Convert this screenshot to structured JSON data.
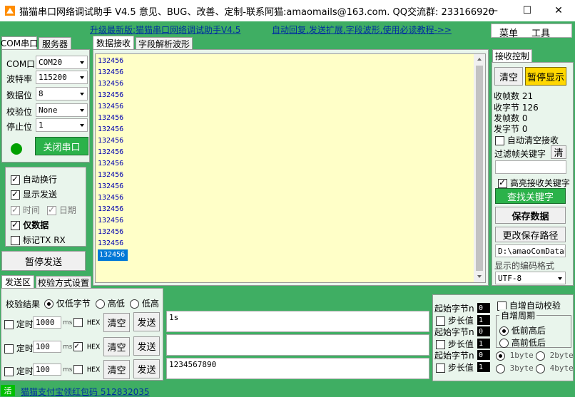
{
  "window": {
    "title": "猫猫串口网络调试助手 V4.5 意见、BUG、改善、定制-联系阿猫:amaomails@163.com. QQ交流群: 233166920",
    "minimize": "—",
    "maximize": "☐",
    "close": "✕"
  },
  "topbar": {
    "upgrade_link": "升级最新版:猫猫串口网络调试助手V4.5",
    "auto_reply_link": "自动回复,发送扩展,字段波形,使用必读教程->>",
    "menu": "菜单",
    "tools": "工具"
  },
  "left_tabs": {
    "com": "COM串口",
    "server": "服务器"
  },
  "com_settings": {
    "port_label": "COM口",
    "port_value": "COM20",
    "baud_label": "波特率",
    "baud_value": "115200",
    "data_label": "数据位",
    "data_value": "8",
    "parity_label": "校验位",
    "parity_value": "None",
    "stop_label": "停止位",
    "stop_value": "1",
    "close_port": "关闭串口",
    "indicator_color": "#00a000"
  },
  "options": {
    "auto_newline": "自动换行",
    "show_send": "显示发送",
    "time": "时间",
    "date": "日期",
    "data_only": "仅数据",
    "mark_tx_rx": "标记TX RX"
  },
  "pause_send": "暂停发送",
  "recv_tabs": {
    "data_recv": "数据接收",
    "field_wave": "字段解析波形"
  },
  "recv_lines": [
    "132456",
    "132456",
    "132456",
    "132456",
    "132456",
    "132456",
    "132456",
    "132456",
    "132456",
    "132456",
    "132456",
    "132456",
    "132456",
    "132456",
    "132456",
    "132456",
    "132456",
    "132456"
  ],
  "recv_ctrl": {
    "tab": "接收控制",
    "clear": "清空",
    "pause_display": "暂停显示",
    "rx_frames": "收帧数 21",
    "rx_bytes": "收字节 126",
    "tx_frames": "发帧数 0",
    "tx_bytes": "发字节 0",
    "auto_clear": "自动清空接收",
    "filter_label": "过滤帧关键字",
    "filter_clear": "清",
    "highlight": "高亮接收关键字",
    "find_key": "查找关键字",
    "save_data": "保存数据",
    "change_path": "更改保存路径",
    "path_value": "D:\\amaoComDataLo",
    "encoding_label": "显示的编码格式",
    "encoding_value": "UTF-8"
  },
  "send_tabs": {
    "send_area": "发送区",
    "checksum": "校验方式设置"
  },
  "send_panel": {
    "check_result": "校验结果",
    "only_low": "仅低字节",
    "high_low": "高低",
    "low_high": "低高",
    "rows": [
      {
        "timer": "定时",
        "ms": "1000",
        "ms_unit": "ms",
        "hex": "HEX",
        "hex_on": false,
        "clear": "清空",
        "send": "发送",
        "content": "1s"
      },
      {
        "timer": "定时",
        "ms": "100",
        "ms_unit": "ms",
        "hex": "HEX",
        "hex_on": true,
        "clear": "清空",
        "send": "发送",
        "content": ""
      },
      {
        "timer": "定时",
        "ms": "100",
        "ms_unit": "ms",
        "hex": "HEX",
        "hex_on": false,
        "clear": "清空",
        "send": "发送",
        "content": "1234567890"
      }
    ]
  },
  "checksum_panel": {
    "start_byte": "起始字节n",
    "step": "步长值",
    "start_val": "0",
    "step_val": "1",
    "auto_inc": "自增自动校验",
    "inc_cycle": "自增周期",
    "low_first": "低前高后",
    "high_first": "高前低后",
    "b1": "1byte",
    "b2": "2byte",
    "b3": "3byte",
    "b4": "4byte"
  },
  "statusbar": {
    "status": "活",
    "alipay": "猫猫支付宝领红包码 512832035"
  }
}
